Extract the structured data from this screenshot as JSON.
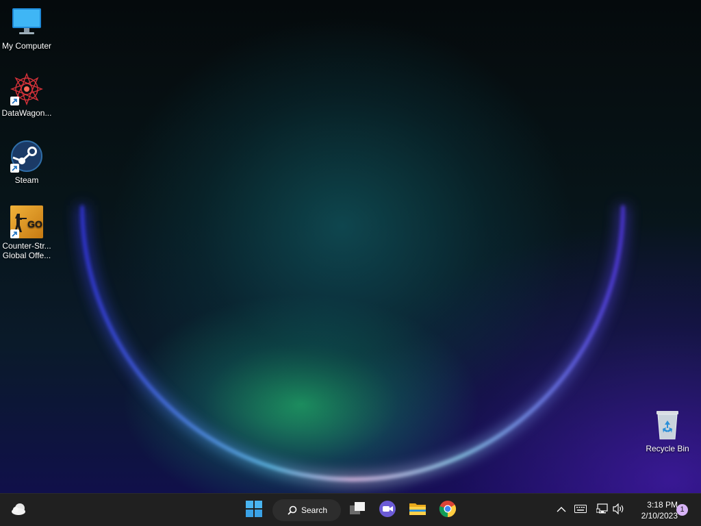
{
  "desktop": {
    "icons": [
      {
        "label": "My Computer",
        "icon": "monitor-icon"
      },
      {
        "label": "DataWagon...",
        "icon": "datawagon-icon"
      },
      {
        "label": "Steam",
        "icon": "steam-icon"
      },
      {
        "label": "Counter-Str...\nGlobal Offe...",
        "icon": "csgo-icon"
      },
      {
        "label": "Recycle Bin",
        "icon": "recycle-bin-icon"
      }
    ],
    "csgo_logo_text": "GO"
  },
  "taskbar": {
    "widgets_icon": "weather-icon",
    "start_icon": "windows-start-icon",
    "search_label": "Search",
    "pinned": [
      {
        "name": "task-view",
        "icon": "task-view-icon"
      },
      {
        "name": "meet",
        "icon": "video-chat-icon"
      },
      {
        "name": "file-explorer",
        "icon": "folder-icon"
      },
      {
        "name": "chrome",
        "icon": "chrome-icon"
      }
    ],
    "tray": {
      "overflow_icon": "chevron-up-icon",
      "keyboard_icon": "keyboard-icon",
      "network_icon": "network-icon",
      "volume_icon": "speaker-icon"
    },
    "time": "3:18 PM",
    "date": "2/10/2023",
    "notification_count": "1"
  },
  "colors": {
    "taskbar_bg": "#202020",
    "accent_blue": "#2b8fd8",
    "badge": "#d8b4f8"
  }
}
